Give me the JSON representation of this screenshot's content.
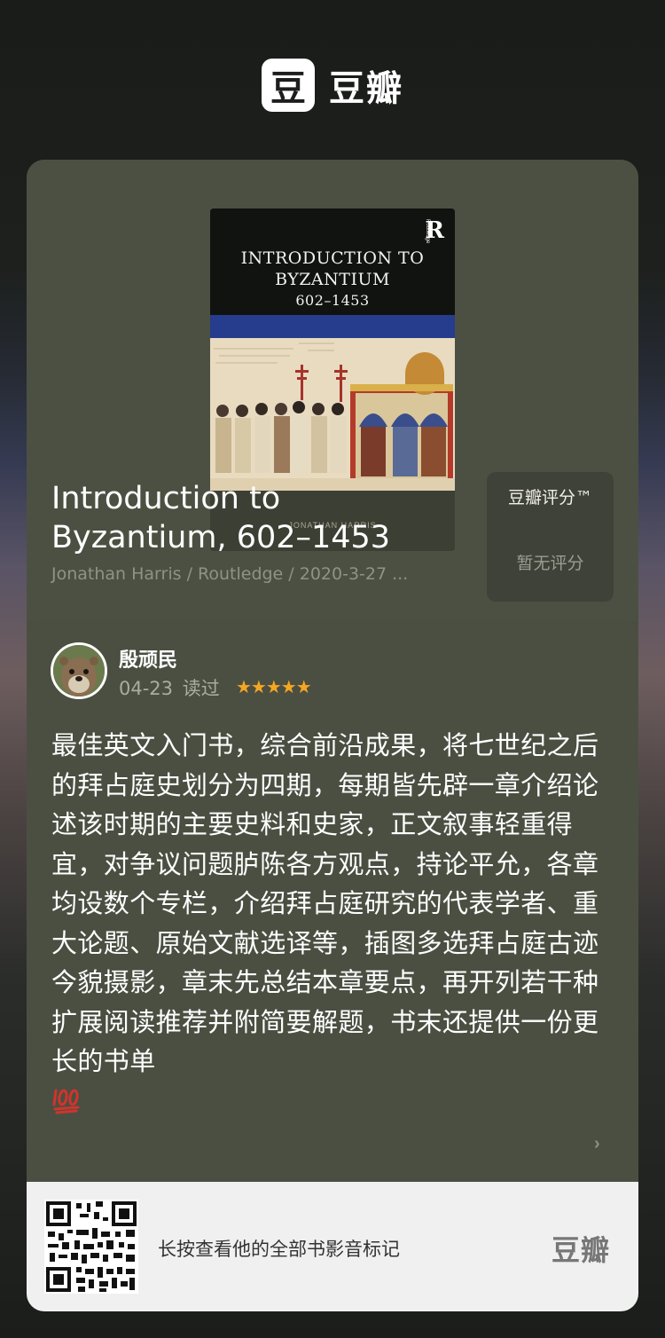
{
  "app": {
    "logo_icon": "豆",
    "logo_text": "豆瓣"
  },
  "book": {
    "cover": {
      "title_line1": "INTRODUCTION TO",
      "title_line2": "BYZANTIUM",
      "title_line3": "602–1453",
      "publisher_mark": "R",
      "publisher_small": "Routledge",
      "author": "JONATHAN HARRIS"
    },
    "title": "Introduction to Byzantium, 602–1453",
    "meta": "Jonathan Harris / Routledge / 2020-3-27 ..."
  },
  "rating": {
    "label": "豆瓣评分™",
    "value": "暂无评分"
  },
  "review": {
    "reviewer": "殷顽民",
    "date": "04-23",
    "status": "读过",
    "stars": "★★★★★",
    "star_count": 5,
    "text": "最佳英文入门书，综合前沿成果，将七世纪之后的拜占庭史划分为四期，每期皆先辟一章介绍论述该时期的主要史料和史家，正文叙事轻重得宜，对争议问题胪陈各方观点，持论平允，各章均设数个专栏，介绍拜占庭研究的代表学者、重大论题、原始文献选译等，插图多选拜占庭古迹今貌摄影，章末先总结本章要点，再开列若干种扩展阅读推荐并附简要解题，书末还提供一份更长的书单",
    "emoji_icon": "hundred-points-icon"
  },
  "footer": {
    "prompt": "长按查看他的全部书影音标记",
    "brand": "豆瓣"
  },
  "colors": {
    "card_bg": "#4b4f42",
    "star": "#f5a623",
    "footer_bg": "#f0f0f0"
  }
}
